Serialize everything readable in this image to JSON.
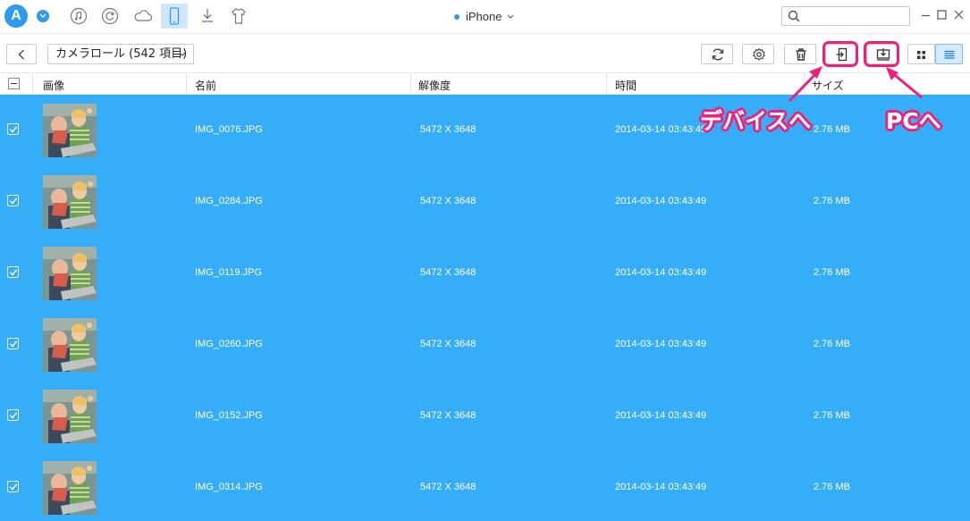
{
  "topbar": {
    "logo_letter": "A",
    "device_name": "iPhone",
    "nav_icons": [
      "music-icon",
      "restore-icon",
      "cloud-icon",
      "phone-icon",
      "download-icon",
      "shirt-icon"
    ],
    "active_nav": "phone-icon",
    "search_placeholder": ""
  },
  "toolbar": {
    "album_label": "カメラロール (542 項目)",
    "buttons": [
      "refresh-icon",
      "settings-icon",
      "trash-icon",
      "to-device-icon",
      "to-pc-icon",
      "grid-view-icon",
      "list-view-icon"
    ],
    "active_view": "list-view-icon"
  },
  "table": {
    "headers": {
      "image": "画像",
      "name": "名前",
      "resolution": "解像度",
      "time": "時間",
      "size": "サイズ"
    },
    "rows": [
      {
        "name": "IMG_0076.JPG",
        "resolution": "5472 X 3648",
        "time": "2014-03-14 03:43:49",
        "size": "2.76 MB",
        "checked": true
      },
      {
        "name": "IMG_0284.JPG",
        "resolution": "5472 X 3648",
        "time": "2014-03-14 03:43:49",
        "size": "2.76 MB",
        "checked": true
      },
      {
        "name": "IMG_0119.JPG",
        "resolution": "5472 X 3648",
        "time": "2014-03-14 03:43:49",
        "size": "2.76 MB",
        "checked": true
      },
      {
        "name": "IMG_0260.JPG",
        "resolution": "5472 X 3648",
        "time": "2014-03-14 03:43:49",
        "size": "2.76 MB",
        "checked": true
      },
      {
        "name": "IMG_0152.JPG",
        "resolution": "5472 X 3648",
        "time": "2014-03-14 03:43:49",
        "size": "2.76 MB",
        "checked": true
      },
      {
        "name": "IMG_0314.JPG",
        "resolution": "5472 X 3648",
        "time": "2014-03-14 03:43:49",
        "size": "2.76 MB",
        "checked": true
      }
    ]
  },
  "annotations": {
    "to_device": "デバイスへ",
    "to_pc": "PCへ"
  },
  "colors": {
    "accent": "#2f9bf0",
    "selection": "#35adf7",
    "highlight": "#f0207a"
  }
}
